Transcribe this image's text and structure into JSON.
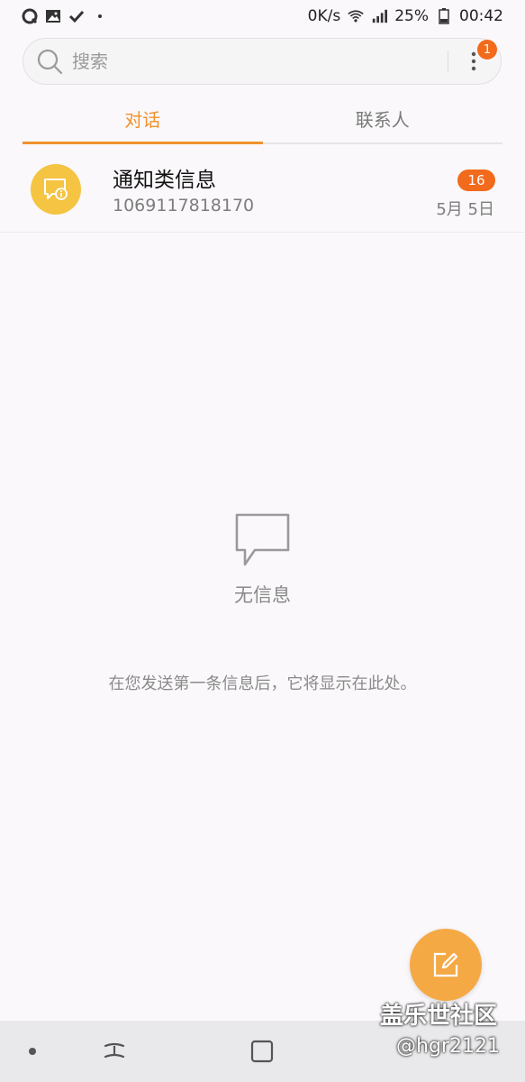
{
  "status_bar": {
    "net_speed": "0K/s",
    "battery": "25%",
    "time": "00:42",
    "icons": [
      "q-app-icon",
      "gallery-icon",
      "check-icon",
      "wifi-icon",
      "signal-icon",
      "battery-icon"
    ]
  },
  "search": {
    "placeholder": "搜索",
    "more_badge": "1"
  },
  "tabs": [
    {
      "label": "对话",
      "active": true
    },
    {
      "label": "联系人",
      "active": false
    }
  ],
  "conversation": {
    "name": "通知类信息",
    "number": "1069117818170",
    "unread": "16",
    "date": "5月 5日"
  },
  "empty_state": {
    "title": "无信息",
    "hint": "在您发送第一条信息后，它将显示在此处。"
  },
  "watermark": {
    "line1": "盖乐世社区",
    "line2": "@hgr2121"
  },
  "colors": {
    "accent": "#f0922d",
    "badge": "#f26a1b",
    "avatar": "#f4c442",
    "fab": "#f5a945"
  }
}
